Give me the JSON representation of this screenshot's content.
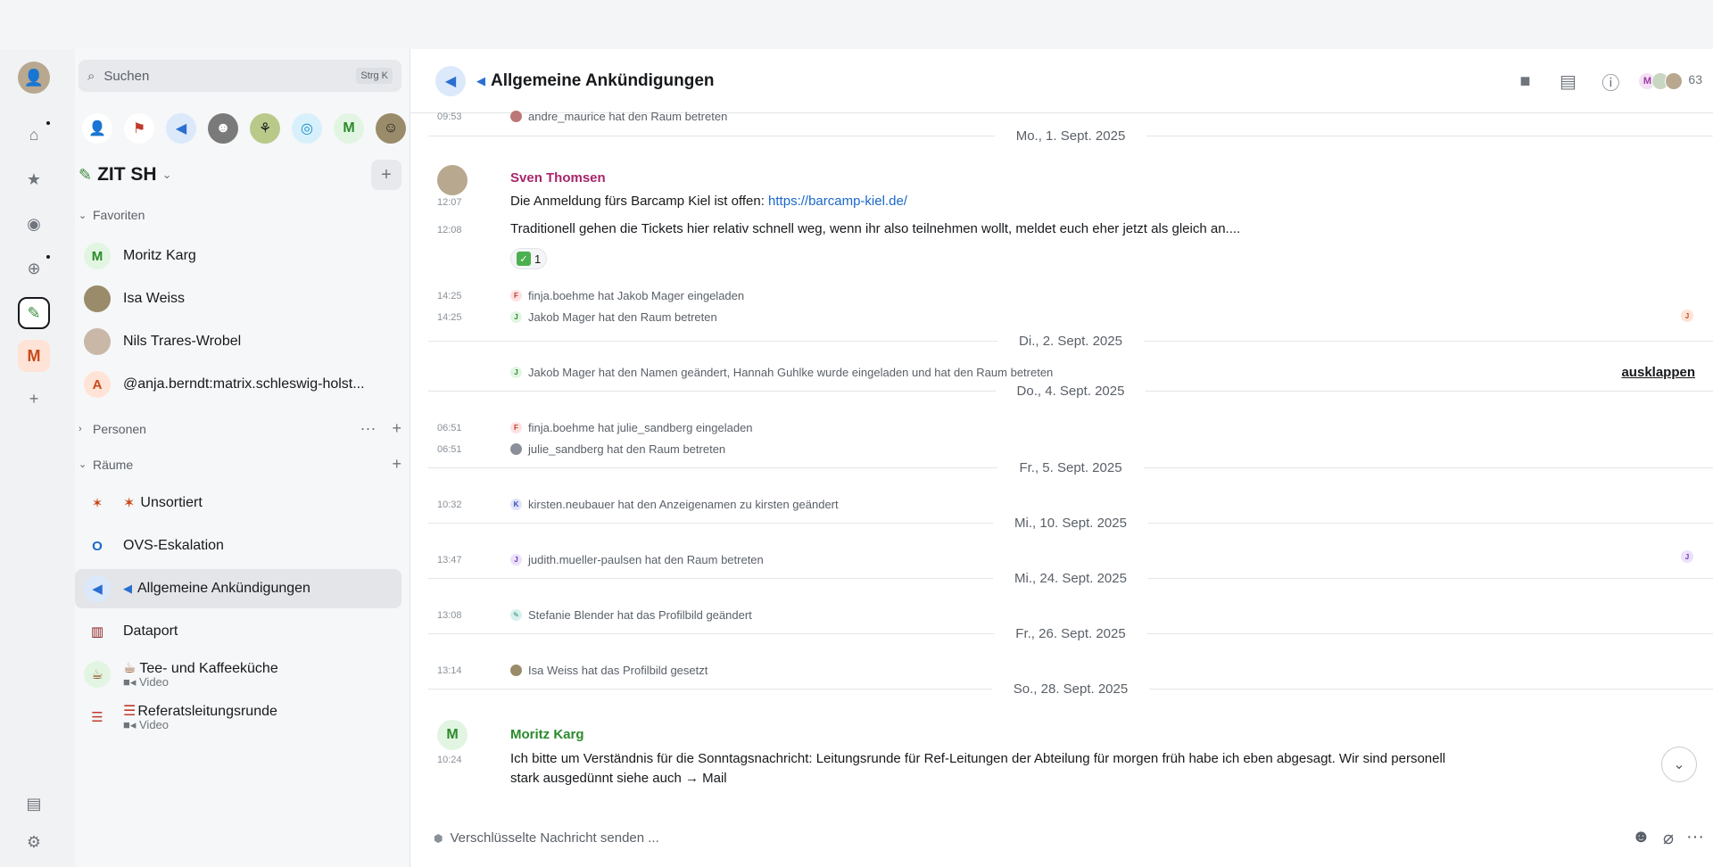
{
  "app": {
    "accent": "#1a68c9",
    "search": {
      "placeholder": "Suchen",
      "shortcut": "Strg K"
    },
    "space": {
      "name": "ZIT SH"
    }
  },
  "sidebar": {
    "sections": {
      "favorites": "Favoriten",
      "people": "Personen",
      "rooms": "Räume"
    },
    "favorites": [
      {
        "name": "Moritz Karg",
        "avatar": "M"
      },
      {
        "name": "Isa Weiss",
        "avatar": ""
      },
      {
        "name": "Nils Trares-Wrobel",
        "avatar": ""
      },
      {
        "name": "@anja.berndt:matrix.schleswig-holst...",
        "avatar": "A"
      }
    ],
    "rooms": [
      {
        "name": "Unsortiert",
        "avatar": ""
      },
      {
        "name": "OVS-Eskalation",
        "avatar": "O"
      },
      {
        "name": "Allgemeine Ankündigungen",
        "avatar": ""
      },
      {
        "name": "Dataport",
        "avatar": ""
      },
      {
        "name": "Tee- und Kaffeeküche",
        "avatar": "",
        "sub": "Video"
      },
      {
        "name": "Referatsleitungsrunde",
        "avatar": "",
        "sub": "Video"
      }
    ]
  },
  "room": {
    "title": "Allgemeine Ankündigungen",
    "member_count": "63",
    "member_initial": "M"
  },
  "timeline": {
    "top_event": {
      "time": "09:53",
      "text": "andre_maurice hat den Raum betreten"
    },
    "dates": {
      "d1": "Mo., 1. Sept. 2025",
      "d2": "Di., 2. Sept. 2025",
      "d3": "Do., 4. Sept. 2025",
      "d4": "Fr., 5. Sept. 2025",
      "d5": "Mi., 10. Sept. 2025",
      "d6": "Mi., 24. Sept. 2025",
      "d7": "Fr., 26. Sept. 2025",
      "d8": "So., 28. Sept. 2025"
    },
    "sven": {
      "name": "Sven Thomsen",
      "t1": "12:07",
      "m1_text": "Die Anmeldung fürs Barcamp Kiel ist offen: ",
      "m1_link": "https://barcamp-kiel.de/",
      "t2": "12:08",
      "m2": "Traditionell gehen die Tickets hier relativ schnell weg, wenn ihr also teilnehmen wollt, meldet euch eher jetzt als gleich an....",
      "reaction_count": "1"
    },
    "events": {
      "e1_time": "14:25",
      "e1": "finja.boehme hat Jakob Mager eingeladen",
      "e2_time": "14:25",
      "e2": "Jakob Mager hat den Raum betreten",
      "e3": "Jakob Mager hat den Namen geändert, Hannah Guhlke wurde eingeladen und hat den Raum betreten",
      "expand": "ausklappen",
      "e4_time": "06:51",
      "e4": "finja.boehme hat julie_sandberg eingeladen",
      "e5_time": "06:51",
      "e5": "julie_sandberg hat den Raum betreten",
      "e6_time": "10:32",
      "e6": "kirsten.neubauer hat den Anzeigenamen zu kirsten geändert",
      "e7_time": "13:47",
      "e7": "judith.mueller-paulsen hat den Raum betreten",
      "e8_time": "13:08",
      "e8": "Stefanie Blender hat das Profilbild geändert",
      "e9_time": "13:14",
      "e9": "Isa Weiss hat das Profilbild gesetzt"
    },
    "moritz": {
      "name": "Moritz Karg",
      "time": "10:24",
      "line1": "Ich bitte um Verständnis für die Sonntagsnachricht: Leitungsrunde für Ref-Leitungen der Abteilung für morgen früh habe ich eben abgesagt. Wir sind personell",
      "line2": "stark ausgedünnt siehe auch → Mail"
    }
  },
  "composer": {
    "placeholder": "Verschlüsselte Nachricht senden ..."
  }
}
